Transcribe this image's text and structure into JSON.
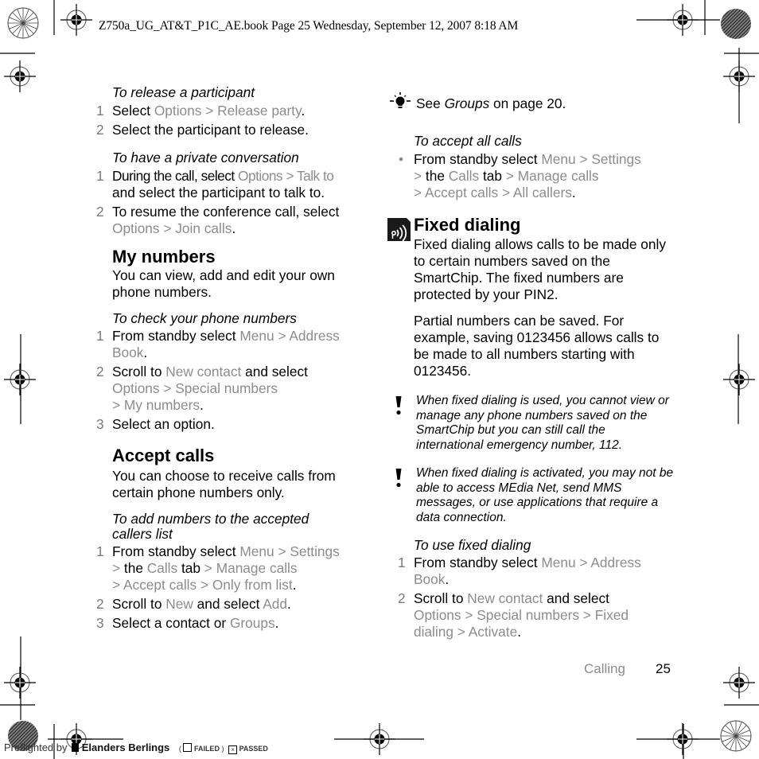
{
  "print_header": "Z750a_UG_AT&T_P1C_AE.book  Page 25  Wednesday, September 12, 2007  8:18 AM",
  "left": {
    "release": {
      "title": "To release a participant",
      "steps": [
        {
          "num": "1",
          "t1": "Select ",
          "g1": "Options",
          "t2": " > ",
          "g2": "Release party",
          "t3": "."
        },
        {
          "num": "2",
          "text": "Select the participant to release."
        }
      ]
    },
    "private": {
      "title": "To have a private conversation",
      "steps": [
        {
          "num": "1",
          "t1": "During the call, select ",
          "g1": "Options",
          "sep": " > ",
          "g2": "Talk to",
          "t2": "and select the participant to talk to."
        },
        {
          "num": "2",
          "t1": "To resume the conference call, select",
          "g1": "Options",
          "sep": " > ",
          "g2": "Join calls",
          "t2": "."
        }
      ]
    },
    "my_numbers": {
      "heading": "My numbers",
      "intro": "You can view, add and edit your own phone numbers.",
      "sub": "To check your phone numbers",
      "steps": [
        {
          "num": "1",
          "t1": "From standby select ",
          "g1": "Menu",
          "sep": " > ",
          "g2": "Address Book",
          "t2": "."
        },
        {
          "num": "2",
          "t1": "Scroll to ",
          "g1": "New contact",
          "t2": " and select",
          "g2": "Options",
          "sep": " > ",
          "g3": "Special numbers",
          "g4": "> My numbers",
          "t3": "."
        },
        {
          "num": "3",
          "text": "Select an option."
        }
      ]
    },
    "accept_calls": {
      "heading": "Accept calls",
      "intro": "You can choose to receive calls from certain phone numbers only.",
      "sub": "To add numbers to the accepted callers list",
      "steps": [
        {
          "num": "1",
          "t1": "From standby select ",
          "g1": "Menu",
          "sep": " > ",
          "g2": "Settings",
          "g3": "> ",
          "t2": "the ",
          "g4": "Calls",
          "t3": " tab ",
          "g5": "> Manage calls",
          "g6": "> Accept calls",
          "g7": " > ",
          "g8": "Only from list",
          "t4": "."
        },
        {
          "num": "2",
          "t1": "Scroll to ",
          "g1": "New",
          "t2": " and select ",
          "g2": "Add",
          "t3": "."
        },
        {
          "num": "3",
          "t1": "Select a contact or ",
          "g1": "Groups",
          "t2": "."
        }
      ]
    }
  },
  "right": {
    "tip": {
      "icon": "lightbulb-icon",
      "t1": "See ",
      "i1": "Groups",
      "t2": " on page 20."
    },
    "accept_all": {
      "title": "To accept all calls",
      "t1": "From standby select ",
      "g1": "Menu",
      "sep": " > ",
      "g2": "Settings",
      "g3": "> ",
      "t2": "the ",
      "g4": "Calls",
      "t3": " tab ",
      "g5": "> Manage calls",
      "g6": "> Accept calls",
      "g7": " > ",
      "g8": "All callers",
      "t4": "."
    },
    "fixed": {
      "heading": "Fixed dialing",
      "para1": "Fixed dialing allows calls to be made only to certain numbers saved on the SmartChip. The fixed numbers are protected by your PIN2.",
      "para2": "Partial numbers can be saved. For example, saving 0123456 allows calls to be made to all numbers starting with 0123456.",
      "note1": "When fixed dialing is used, you cannot view or manage any phone numbers saved on the SmartChip but you can still call the international emergency number, 112.",
      "note2": "When fixed dialing is activated, you may not be able to access MEdia Net, send MMS messages, or use applications that require a data connection.",
      "sub": "To use fixed dialing",
      "steps": [
        {
          "num": "1",
          "t1": "From standby select ",
          "g1": "Menu",
          "sep": " > ",
          "g2": "Address",
          "g3": "Book",
          "t2": "."
        },
        {
          "num": "2",
          "t1": "Scroll to ",
          "g1": "New contact",
          "t2": " and select",
          "g2": "Options",
          "sep1": " > ",
          "g3": "Special numbers",
          "sep2": " > ",
          "g4": "Fixed",
          "g5": "dialing",
          "sep3": " > ",
          "g6": "Activate",
          "t3": "."
        }
      ]
    }
  },
  "footer": {
    "section": "Calling",
    "page": "25"
  },
  "preflight": {
    "label": "Preflighted by",
    "brand": "Elanders Berlings",
    "failed": "FAILED",
    "passed": "PASSED"
  },
  "colors": {
    "gray_text": "#8c8c8c",
    "step_num": "#7a7a7a"
  }
}
